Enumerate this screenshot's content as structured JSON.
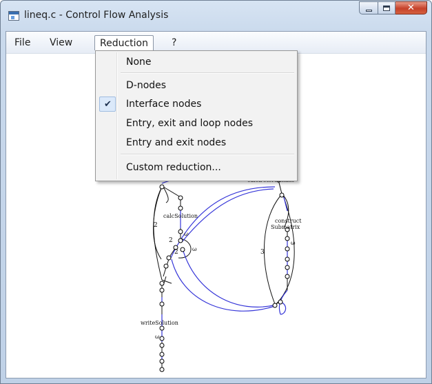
{
  "window": {
    "title": "lineq.c - Control Flow Analysis",
    "close_glyph": "✕"
  },
  "menubar": {
    "items": [
      {
        "label": "File"
      },
      {
        "label": "View"
      },
      {
        "label": "Reduction"
      },
      {
        "label": "?"
      }
    ]
  },
  "reduction_menu": {
    "items": [
      {
        "label": "None",
        "checked": false
      },
      {
        "label": "D-nodes",
        "checked": false
      },
      {
        "label": "Interface nodes",
        "checked": true
      },
      {
        "label": "Entry, exit and loop nodes",
        "checked": false
      },
      {
        "label": "Entry and exit nodes",
        "checked": false
      },
      {
        "label": "Custom reduction...",
        "checked": false
      }
    ],
    "check_glyph": "✔"
  },
  "graph": {
    "function_labels": {
      "calc_determinant": "calcDeterminant",
      "calc_solution": "calcSolution",
      "construct_submatrix_1": "construct",
      "construct_submatrix_2": "Submatrix",
      "write_solution": "writeSolution"
    },
    "edge_counts": {
      "left_loop": "2",
      "inner_loop": "2",
      "inner_loop_2": "2",
      "right_loop": "3"
    },
    "omega_labels": {
      "calc_solution": "ω",
      "inner": "ω",
      "construct": "ω",
      "write_solution": "ω"
    },
    "colors": {
      "edge_black": "#111111",
      "edge_blue": "#3434d8"
    }
  },
  "colors": {
    "accent_check_bg": "#dbe9fa",
    "close_button": "#c6412a",
    "menu_bg": "#f2f2f2"
  }
}
